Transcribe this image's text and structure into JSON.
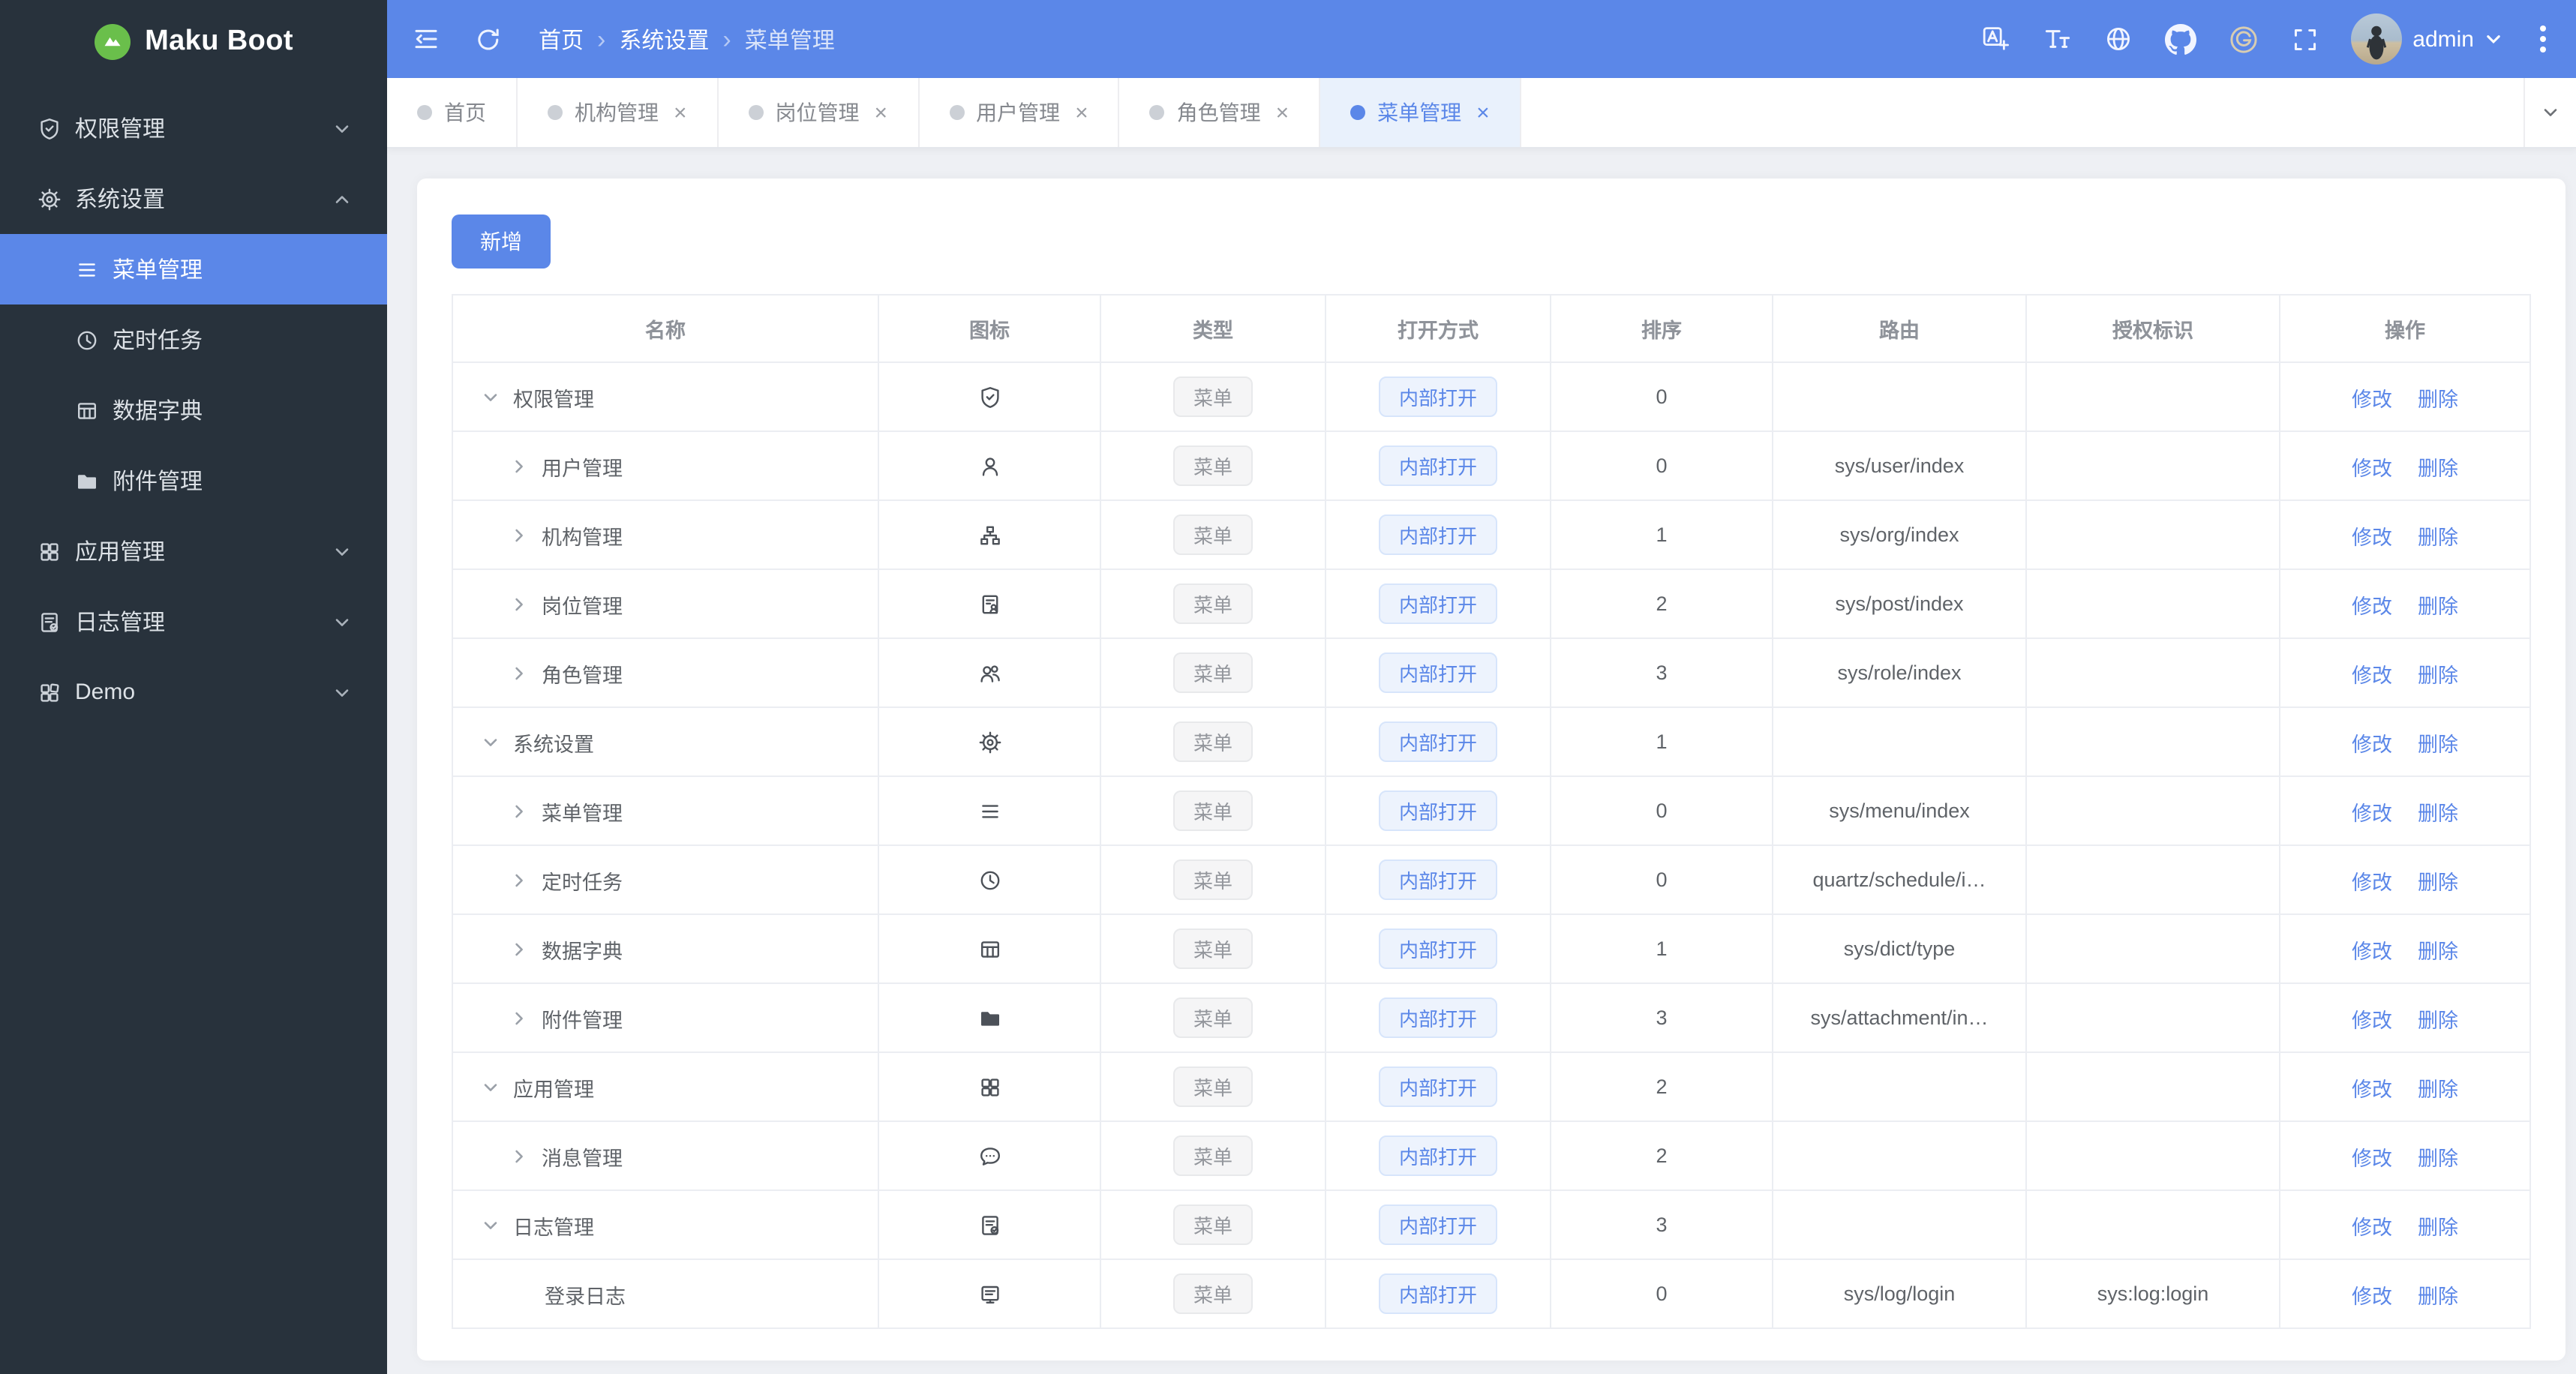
{
  "accent": "#5b87e8",
  "sidebar": {
    "logo_text": "Maku Boot",
    "items": [
      {
        "label": "权限管理",
        "icon": "shield",
        "chevron": "down",
        "active": false,
        "children": []
      },
      {
        "label": "系统设置",
        "icon": "gear",
        "chevron": "up",
        "active": false,
        "children": [
          {
            "label": "菜单管理",
            "icon": "menu",
            "active": true
          },
          {
            "label": "定时任务",
            "icon": "clock",
            "active": false
          },
          {
            "label": "数据字典",
            "icon": "dict",
            "active": false
          },
          {
            "label": "附件管理",
            "icon": "folder",
            "active": false
          }
        ]
      },
      {
        "label": "应用管理",
        "icon": "grid",
        "chevron": "down",
        "active": false,
        "children": []
      },
      {
        "label": "日志管理",
        "icon": "log",
        "chevron": "down",
        "active": false,
        "children": []
      },
      {
        "label": "Demo",
        "icon": "grid2",
        "chevron": "down",
        "active": false,
        "children": []
      }
    ]
  },
  "header": {
    "breadcrumb": [
      "首页",
      "系统设置",
      "菜单管理"
    ],
    "action_icons": [
      "language",
      "fontsize",
      "globe",
      "github",
      "gitee",
      "fullscreen"
    ],
    "user_name": "admin"
  },
  "tabs": [
    {
      "label": "首页",
      "closable": false,
      "active": false
    },
    {
      "label": "机构管理",
      "closable": true,
      "active": false
    },
    {
      "label": "岗位管理",
      "closable": true,
      "active": false
    },
    {
      "label": "用户管理",
      "closable": true,
      "active": false
    },
    {
      "label": "角色管理",
      "closable": true,
      "active": false
    },
    {
      "label": "菜单管理",
      "closable": true,
      "active": true
    }
  ],
  "toolbar": {
    "add_label": "新增"
  },
  "table": {
    "columns": [
      "名称",
      "图标",
      "类型",
      "打开方式",
      "排序",
      "路由",
      "授权标识",
      "操作"
    ],
    "type_label": "菜单",
    "open_label": "内部打开",
    "edit_label": "修改",
    "delete_label": "删除",
    "rows": [
      {
        "arrow": "down",
        "level": 0,
        "name": "权限管理",
        "icon": "shield",
        "sort": "0",
        "route": "",
        "auth": ""
      },
      {
        "arrow": "right",
        "level": 1,
        "name": "用户管理",
        "icon": "user",
        "sort": "0",
        "route": "sys/user/index",
        "auth": ""
      },
      {
        "arrow": "right",
        "level": 1,
        "name": "机构管理",
        "icon": "org",
        "sort": "1",
        "route": "sys/org/index",
        "auth": ""
      },
      {
        "arrow": "right",
        "level": 1,
        "name": "岗位管理",
        "icon": "post",
        "sort": "2",
        "route": "sys/post/index",
        "auth": ""
      },
      {
        "arrow": "right",
        "level": 1,
        "name": "角色管理",
        "icon": "role",
        "sort": "3",
        "route": "sys/role/index",
        "auth": ""
      },
      {
        "arrow": "down",
        "level": 0,
        "name": "系统设置",
        "icon": "gear",
        "sort": "1",
        "route": "",
        "auth": ""
      },
      {
        "arrow": "right",
        "level": 1,
        "name": "菜单管理",
        "icon": "menu",
        "sort": "0",
        "route": "sys/menu/index",
        "auth": ""
      },
      {
        "arrow": "right",
        "level": 1,
        "name": "定时任务",
        "icon": "clock",
        "sort": "0",
        "route": "quartz/schedule/i…",
        "auth": ""
      },
      {
        "arrow": "right",
        "level": 1,
        "name": "数据字典",
        "icon": "dict",
        "sort": "1",
        "route": "sys/dict/type",
        "auth": ""
      },
      {
        "arrow": "right",
        "level": 1,
        "name": "附件管理",
        "icon": "folder",
        "sort": "3",
        "route": "sys/attachment/in…",
        "auth": ""
      },
      {
        "arrow": "down",
        "level": 0,
        "name": "应用管理",
        "icon": "grid",
        "sort": "2",
        "route": "",
        "auth": ""
      },
      {
        "arrow": "right",
        "level": 1,
        "name": "消息管理",
        "icon": "message",
        "sort": "2",
        "route": "",
        "auth": ""
      },
      {
        "arrow": "down",
        "level": 0,
        "name": "日志管理",
        "icon": "log",
        "sort": "3",
        "route": "",
        "auth": ""
      },
      {
        "arrow": "none",
        "level": 1,
        "name": "登录日志",
        "icon": "loginlog",
        "sort": "0",
        "route": "sys/log/login",
        "auth": "sys:log:login"
      }
    ]
  }
}
